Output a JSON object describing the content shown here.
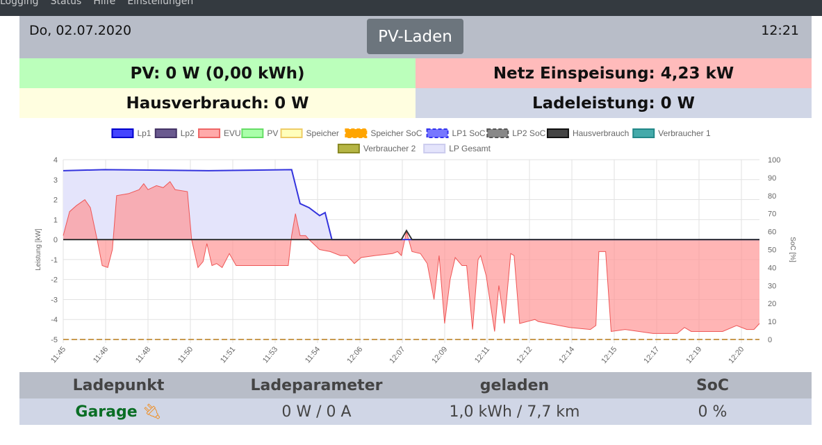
{
  "nav": {
    "items": [
      "Logging",
      "Status",
      "Hilfe",
      "Einstellungen"
    ]
  },
  "header": {
    "date": "Do, 02.07.2020",
    "mode": "PV-Laden",
    "time": "12:21"
  },
  "summary": {
    "pv": "PV: 0 W (0,00 kWh)",
    "netz": "Netz Einspeisung: 4,23 kW",
    "haus": "Hausverbrauch: 0 W",
    "lade": "Ladeleistung: 0 W"
  },
  "colors": {
    "pv_bg": "#bbffbb",
    "netz_bg": "#ffbbbb",
    "haus_bg": "#fffee0",
    "lade_bg": "#d0d6e6",
    "header_bg": "#b8bdc8",
    "garage": "#0a6e25",
    "plug": "#f08c1e"
  },
  "chart_data": {
    "type": "line",
    "ylabel": "Leistung [kW]",
    "y2label": "SoC [%]",
    "ylim": [
      -5,
      4
    ],
    "y2lim": [
      0,
      100
    ],
    "yticks": [
      "4",
      "3",
      "2",
      "1",
      "0",
      "-1",
      "-2",
      "-3",
      "-4",
      "-5"
    ],
    "y2ticks": [
      "100",
      "90",
      "80",
      "70",
      "60",
      "50",
      "40",
      "30",
      "20",
      "10",
      "0"
    ],
    "xticks": [
      "11:45",
      "11:46",
      "11:48",
      "11:50",
      "11:51",
      "11:53",
      "11:54",
      "12:06",
      "12:07",
      "12:09",
      "12:11",
      "12:12",
      "12:14",
      "12:15",
      "12:17",
      "12:19",
      "12:20"
    ],
    "xlim": [
      0,
      16.43
    ],
    "legend": [
      {
        "label": "Lp1",
        "fill": "#4444ff",
        "stroke": "#0000cc",
        "dash": false
      },
      {
        "label": "Lp2",
        "fill": "#6a5a8f",
        "stroke": "#443366",
        "dash": false
      },
      {
        "label": "EVU",
        "fill": "#ffaaaa",
        "stroke": "#ee6666",
        "dash": false
      },
      {
        "label": "PV",
        "fill": "#aaffaa",
        "stroke": "#66dd66",
        "dash": false
      },
      {
        "label": "Speicher",
        "fill": "#ffffbb",
        "stroke": "#eecc66",
        "dash": false
      },
      {
        "label": "Speicher SoC",
        "fill": "#ffa500",
        "stroke": "#ffa500",
        "dash": true
      },
      {
        "label": "LP1 SoC",
        "fill": "#7777ff",
        "stroke": "#3333ee",
        "dash": true
      },
      {
        "label": "LP2 SoC",
        "fill": "#888888",
        "stroke": "#555555",
        "dash": true
      },
      {
        "label": "Hausverbrauch",
        "fill": "#444444",
        "stroke": "#111111",
        "dash": false
      },
      {
        "label": "Verbraucher 1",
        "fill": "#44aaaa",
        "stroke": "#228888",
        "dash": false
      },
      {
        "label": "Verbraucher 2",
        "fill": "#b5b544",
        "stroke": "#888822",
        "dash": false
      },
      {
        "label": "LP Gesamt",
        "fill": "#e4e4fb",
        "stroke": "#ccccee",
        "dash": false
      }
    ],
    "series": [
      {
        "name": "LP Gesamt",
        "points": [
          [
            0,
            3.45
          ],
          [
            0.97,
            3.5
          ],
          [
            3.43,
            3.45
          ],
          [
            5.39,
            3.5
          ],
          [
            5.59,
            1.8
          ],
          [
            5.8,
            1.6
          ],
          [
            6.05,
            1.2
          ],
          [
            6.18,
            1.35
          ],
          [
            6.34,
            0
          ],
          [
            16.43,
            0
          ]
        ]
      },
      {
        "name": "EVU",
        "points": [
          [
            0,
            0.2
          ],
          [
            0.15,
            1.4
          ],
          [
            0.31,
            1.7
          ],
          [
            0.51,
            2.0
          ],
          [
            0.64,
            1.6
          ],
          [
            0.8,
            0
          ],
          [
            0.92,
            -1.3
          ],
          [
            1.05,
            -1.4
          ],
          [
            1.16,
            -0.5
          ],
          [
            1.26,
            2.2
          ],
          [
            1.54,
            2.3
          ],
          [
            1.79,
            2.5
          ],
          [
            1.9,
            2.8
          ],
          [
            2.0,
            2.5
          ],
          [
            2.2,
            2.7
          ],
          [
            2.36,
            2.6
          ],
          [
            2.52,
            2.9
          ],
          [
            2.64,
            2.5
          ],
          [
            2.93,
            2.4
          ],
          [
            3.03,
            0
          ],
          [
            3.18,
            -1.4
          ],
          [
            3.3,
            -1.1
          ],
          [
            3.39,
            -0.2
          ],
          [
            3.51,
            -1.3
          ],
          [
            3.62,
            -1.2
          ],
          [
            3.75,
            -1.4
          ],
          [
            3.92,
            -0.7
          ],
          [
            4.08,
            -1.3
          ],
          [
            4.41,
            -1.3
          ],
          [
            5.07,
            -1.3
          ],
          [
            5.31,
            -1.3
          ],
          [
            5.39,
            0.2
          ],
          [
            5.48,
            1.3
          ],
          [
            5.59,
            0.2
          ],
          [
            5.72,
            0.2
          ],
          [
            5.8,
            0
          ],
          [
            6.05,
            -0.5
          ],
          [
            6.3,
            -0.6
          ],
          [
            6.54,
            -0.8
          ],
          [
            6.7,
            -0.8
          ],
          [
            6.87,
            -1.2
          ],
          [
            7.03,
            -0.9
          ],
          [
            7.36,
            -0.8
          ],
          [
            7.77,
            -0.7
          ],
          [
            7.89,
            -0.6
          ],
          [
            7.98,
            -0.8
          ],
          [
            8.1,
            0.4
          ],
          [
            8.23,
            -0.6
          ],
          [
            8.43,
            -0.7
          ],
          [
            8.59,
            -1.2
          ],
          [
            8.75,
            -3.0
          ],
          [
            8.87,
            -0.8
          ],
          [
            9.0,
            -4.2
          ],
          [
            9.13,
            -2.0
          ],
          [
            9.25,
            -0.9
          ],
          [
            9.41,
            -1.3
          ],
          [
            9.52,
            -1.3
          ],
          [
            9.66,
            -4.5
          ],
          [
            9.79,
            -1.0
          ],
          [
            9.85,
            -0.8
          ],
          [
            9.98,
            -1.8
          ],
          [
            10.18,
            -4.6
          ],
          [
            10.28,
            -2.3
          ],
          [
            10.41,
            -4.2
          ],
          [
            10.56,
            -0.7
          ],
          [
            10.64,
            -0.8
          ],
          [
            10.77,
            -4.2
          ],
          [
            11.13,
            -4.0
          ],
          [
            11.21,
            -4.1
          ],
          [
            11.46,
            -4.2
          ],
          [
            11.95,
            -4.4
          ],
          [
            12.44,
            -4.5
          ],
          [
            12.57,
            -4.3
          ],
          [
            12.64,
            -0.6
          ],
          [
            12.8,
            -0.6
          ],
          [
            12.93,
            -4.6
          ],
          [
            13.26,
            -4.5
          ],
          [
            13.92,
            -4.7
          ],
          [
            14.49,
            -4.7
          ],
          [
            14.66,
            -4.4
          ],
          [
            14.82,
            -4.6
          ],
          [
            15.56,
            -4.6
          ],
          [
            15.89,
            -4.3
          ],
          [
            16.13,
            -4.5
          ],
          [
            16.3,
            -4.5
          ],
          [
            16.43,
            -4.2
          ]
        ]
      },
      {
        "name": "Lp1",
        "points": [
          [
            0,
            3.45
          ],
          [
            0.97,
            3.5
          ],
          [
            3.43,
            3.45
          ],
          [
            5.39,
            3.5
          ],
          [
            5.59,
            1.8
          ],
          [
            5.8,
            1.6
          ],
          [
            6.05,
            1.2
          ],
          [
            6.18,
            1.35
          ],
          [
            6.34,
            0
          ],
          [
            16.43,
            0
          ]
        ]
      },
      {
        "name": "Hausverbrauch",
        "points": [
          [
            0,
            0
          ],
          [
            7.98,
            0
          ],
          [
            8.1,
            0.45
          ],
          [
            8.23,
            0
          ],
          [
            16.43,
            0
          ]
        ]
      },
      {
        "name": "Speicher SoC",
        "axis": "soc",
        "points": [
          [
            0,
            0
          ],
          [
            16.43,
            0
          ]
        ]
      }
    ]
  },
  "table": {
    "headers": [
      "Ladepunkt",
      "Ladeparameter",
      "geladen",
      "SoC"
    ],
    "rows": [
      {
        "name": "Garage",
        "param": "0 W / 0 A",
        "geladen": "1,0 kWh / 7,7 km",
        "soc": "0 %"
      }
    ]
  }
}
